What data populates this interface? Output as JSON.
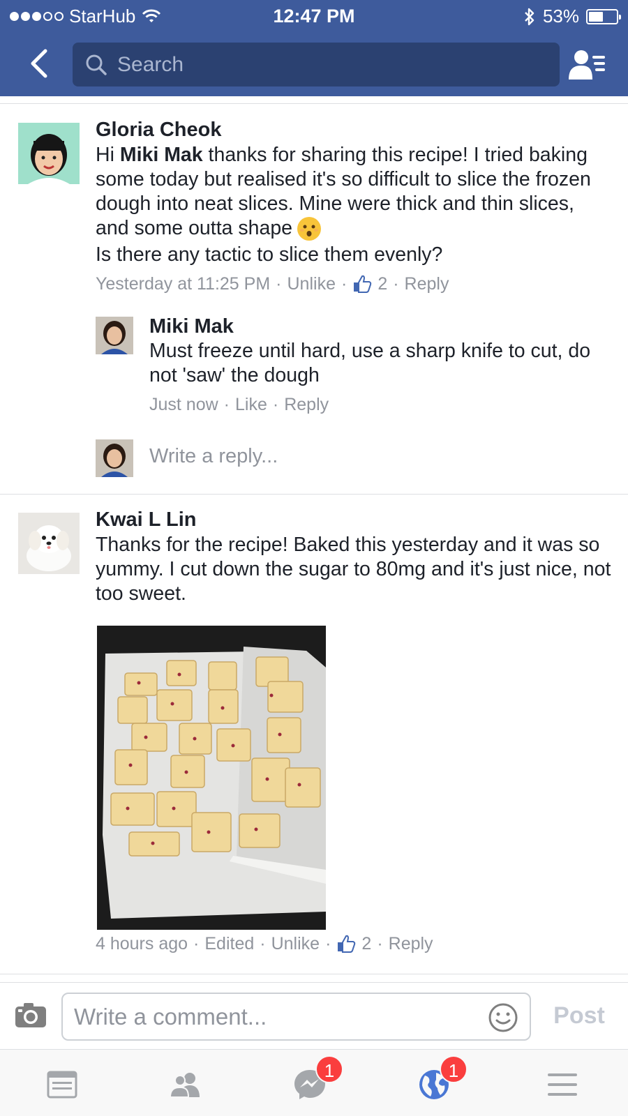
{
  "status_bar": {
    "carrier": "StarHub",
    "time": "12:47 PM",
    "battery": "53%",
    "battery_level": 0.53,
    "signal_bars_filled": 3,
    "signal_bars_total": 5
  },
  "header": {
    "search_placeholder": "Search"
  },
  "comments": [
    {
      "author": "Gloria Cheok",
      "text_before_mention": "Hi ",
      "mention": "Miki Mak",
      "text_after_mention": " thanks for sharing this recipe! I tried baking some today but realised it's so difficult to slice the frozen dough into neat slices. Mine were thick and thin slices, and some outta shape",
      "text_line2": "Is there any tactic to slice them evenly?",
      "timestamp": "Yesterday at 11:25 PM",
      "like_action": "Unlike",
      "like_count": "2",
      "reply_action": "Reply",
      "avatar_icon": "avatar-girl",
      "replies": [
        {
          "author": "Miki Mak",
          "text": "Must freeze until hard, use a sharp knife to cut, do not 'saw' the dough",
          "timestamp": "Just now",
          "like_action": "Like",
          "reply_action": "Reply",
          "avatar_icon": "avatar-woman"
        }
      ],
      "write_reply_placeholder": "Write a reply..."
    },
    {
      "author": "Kwai L Lin",
      "text": "Thanks for the recipe! Baked this yesterday and it was so yummy. I cut down the sugar to 80mg and it's just nice, not too sweet.",
      "timestamp": "4 hours ago",
      "edited": "Edited",
      "like_action": "Unlike",
      "like_count": "2",
      "reply_action": "Reply",
      "avatar_icon": "avatar-dog",
      "photo": "cookies-on-baking-tray-photo"
    }
  ],
  "composer": {
    "placeholder": "Write a comment...",
    "post_label": "Post"
  },
  "tabbar": {
    "messages_badge": "1",
    "notifications_badge": "1"
  },
  "colors": {
    "brand_blue": "#3e5b9c",
    "search_bg": "#2b4171",
    "meta_gray": "#90949c",
    "badge_red": "#fa3e3e"
  }
}
